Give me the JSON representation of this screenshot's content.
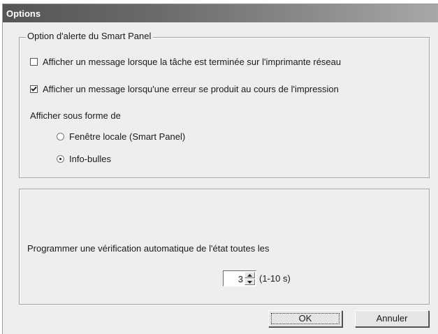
{
  "window": {
    "title": "Options"
  },
  "alert_group": {
    "legend": "Option d'alerte du Smart Panel",
    "checkbox_network": {
      "label": "Afficher un message lorsque la tâche est terminée sur l'imprimante réseau",
      "checked": false
    },
    "checkbox_error": {
      "label": "Afficher un message lorsqu'une erreur se produit au cours de l'impression",
      "checked": true
    },
    "display_as_label": "Afficher sous forme de",
    "radio_options": [
      {
        "label": "Fenêtre locale (Smart Panel)",
        "selected": false
      },
      {
        "label": "Info-bulles",
        "selected": true
      }
    ]
  },
  "status_group": {
    "schedule_label": "Programmer une vérification automatique de l'état toutes les",
    "interval_value": "3",
    "interval_range": "(1-10 s)"
  },
  "buttons": {
    "ok": "OK",
    "cancel": "Annuler"
  }
}
